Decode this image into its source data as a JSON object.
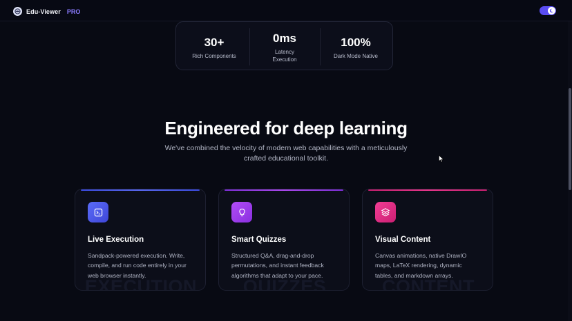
{
  "navbar": {
    "app_name": "Edu-Viewer",
    "pro_badge": "PRO",
    "logo_icon": "globe-logo-icon",
    "theme_toggle_icon": "moon-icon"
  },
  "stats": [
    {
      "value": "30+",
      "label": "Rich Components"
    },
    {
      "value": "0ms",
      "label_line1": "Latency",
      "label_line2": "Execution"
    },
    {
      "value": "100%",
      "label": "Dark Mode Native"
    }
  ],
  "hero": {
    "title": "Engineered for deep learning",
    "subtitle_line1": "We've combined the velocity of modern web capabilities with a meticulously",
    "subtitle_line2": "crafted educational toolkit."
  },
  "features": [
    {
      "title": "Live Execution",
      "icon": "terminal-icon",
      "desc_line1": "Sandpack-powered execution. Write,",
      "desc_line2": "compile, and run code entirely in your",
      "desc_line3": "web browser instantly.",
      "watermark": "EXECUTION",
      "accent": "#4f5df0"
    },
    {
      "title": "Smart Quizzes",
      "icon": "lightbulb-icon",
      "desc_line1": "Structured Q&A, drag-and-drop",
      "desc_line2": "permutations, and instant feedback",
      "desc_line3": "algorithms that adapt to your pace.",
      "watermark": "QUIZZES",
      "accent": "#a63cf0"
    },
    {
      "title": "Visual Content",
      "icon": "layers-icon",
      "desc_line1": "Canvas animations, native DrawIO",
      "desc_line2": "maps, LaTeX rendering, dynamic",
      "desc_line3": "tables, and markdown arrays.",
      "watermark": "CONTENT",
      "accent": "#ec2f8f"
    }
  ]
}
